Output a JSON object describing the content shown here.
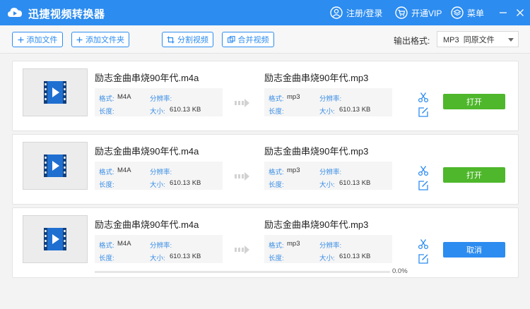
{
  "app": {
    "title": "迅捷视频转换器"
  },
  "titlebar": {
    "register_login": "注册/登录",
    "vip": "开通VIP",
    "menu": "菜单"
  },
  "toolbar": {
    "add_file": "添加文件",
    "add_folder": "添加文件夹",
    "split_video": "分割视频",
    "merge_video": "合并视频",
    "output_format_label": "输出格式:",
    "output_format_value": "MP3  同原文件"
  },
  "labels": {
    "format": "格式:",
    "resolution": "分辨率:",
    "duration": "长度:",
    "size": "大小:"
  },
  "items": [
    {
      "source": {
        "name": "励志金曲串烧90年代.m4a",
        "format": "M4A",
        "size": "610.13 KB"
      },
      "target": {
        "name": "励志金曲串烧90年代.mp3",
        "format": "mp3",
        "size": "610.13 KB"
      },
      "action": "打开"
    },
    {
      "source": {
        "name": "励志金曲串烧90年代.m4a",
        "format": "M4A",
        "size": "610.13 KB"
      },
      "target": {
        "name": "励志金曲串烧90年代.mp3",
        "format": "mp3",
        "size": "610.13 KB"
      },
      "action": "打开"
    },
    {
      "source": {
        "name": "励志金曲串烧90年代.m4a",
        "format": "M4A",
        "size": "610.13 KB"
      },
      "target": {
        "name": "励志金曲串烧90年代.mp3",
        "format": "mp3",
        "size": "610.13 KB"
      },
      "action": "取消",
      "progress": 0,
      "progress_text": "0.0%"
    }
  ],
  "colors": {
    "primary": "#2c8cf0",
    "open_button": "#4eb72b",
    "info_label": "#3a8ee6"
  },
  "icons": {
    "logo": "cloud-video-logo-icon",
    "user": "user-icon",
    "vip": "cart-icon",
    "menu": "layers-icon",
    "thumbnail": "video-film-icon",
    "cut": "scissors-icon",
    "edit": "edit-icon"
  }
}
